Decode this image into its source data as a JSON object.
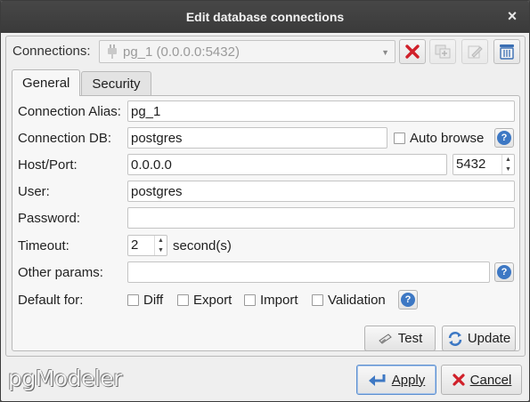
{
  "window": {
    "title": "Edit database connections",
    "close_glyph": "×"
  },
  "connections": {
    "label": "Connections:",
    "selected": "pg_1 (0.0.0.0:5432)",
    "actions": [
      {
        "name": "cancel-edit-button",
        "icon": "red-x-icon",
        "enabled": true
      },
      {
        "name": "duplicate-connection-button",
        "icon": "duplicate-icon",
        "enabled": false
      },
      {
        "name": "edit-connection-button",
        "icon": "edit-icon",
        "enabled": false
      },
      {
        "name": "remove-connection-button",
        "icon": "trash-icon",
        "enabled": true
      }
    ]
  },
  "tabs": [
    {
      "label": "General",
      "active": true
    },
    {
      "label": "Security",
      "active": false
    }
  ],
  "general": {
    "alias": {
      "label": "Connection Alias:",
      "value": "pg_1"
    },
    "db": {
      "label": "Connection DB:",
      "value": "postgres",
      "auto_browse_label": "Auto browse",
      "auto_browse_checked": false
    },
    "host": {
      "label": "Host/Port:",
      "value": "0.0.0.0",
      "port": "5432"
    },
    "user": {
      "label": "User:",
      "value": "postgres"
    },
    "password": {
      "label": "Password:",
      "value": ""
    },
    "timeout": {
      "label": "Timeout:",
      "value": "2",
      "unit": "second(s)"
    },
    "other_params": {
      "label": "Other params:",
      "value": ""
    },
    "default_for": {
      "label": "Default for:",
      "options": [
        {
          "label": "Diff",
          "checked": false
        },
        {
          "label": "Export",
          "checked": false
        },
        {
          "label": "Import",
          "checked": false
        },
        {
          "label": "Validation",
          "checked": false
        }
      ]
    },
    "test_label": "Test",
    "update_label": "Update"
  },
  "footer": {
    "logo_text": "pgModeler",
    "apply_label": "Apply",
    "cancel_label": "Cancel"
  },
  "colors": {
    "titlebar": "#3f3f3f",
    "accent": "#3d78c4",
    "danger": "#d0202a"
  }
}
